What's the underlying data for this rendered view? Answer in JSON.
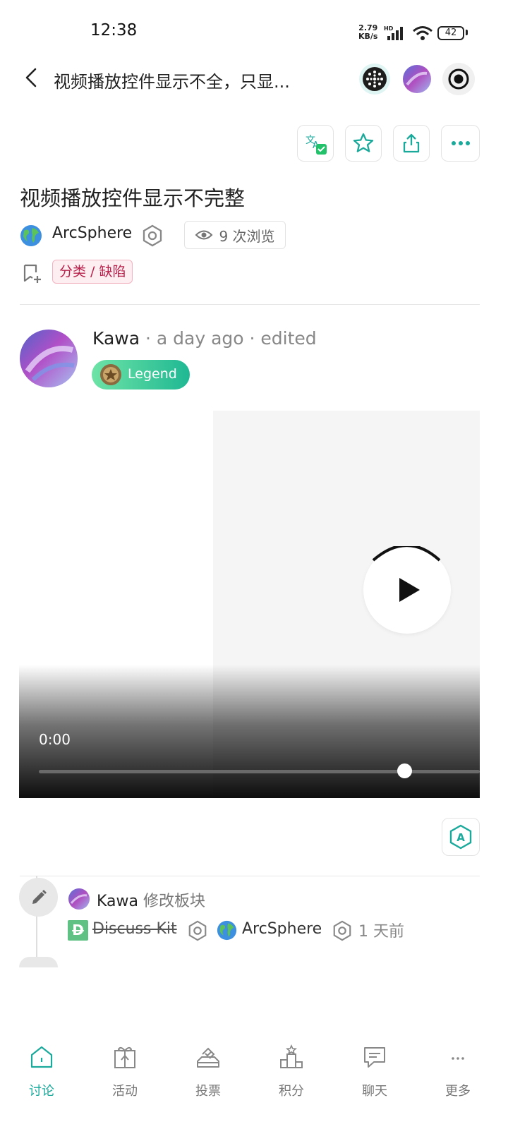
{
  "status_bar": {
    "time": "12:38",
    "net_speed": "2.79",
    "net_unit": "KB/s",
    "hd": "HD",
    "battery": "42"
  },
  "header": {
    "title": "视频播放控件显示不全，只显..."
  },
  "topic": {
    "title": "视频播放控件显示不完整",
    "category": "ArcSphere",
    "views": "9 次浏览",
    "tag": "分类 / 缺陷"
  },
  "post": {
    "author": "Kawa",
    "time_ago": "a day ago",
    "edited": "edited",
    "badge": "Legend",
    "video": {
      "current_time": "0:00",
      "progress": 0.83
    }
  },
  "small_action": {
    "user": "Kawa",
    "verb": "修改板块",
    "old_category": "Discuss Kit",
    "new_category": "ArcSphere",
    "time_ago": "1 天前",
    "old_logo_letter": "D"
  },
  "bottom_nav": {
    "items": [
      {
        "label": "讨论",
        "active": true
      },
      {
        "label": "活动",
        "active": false
      },
      {
        "label": "投票",
        "active": false
      },
      {
        "label": "积分",
        "active": false
      },
      {
        "label": "聊天",
        "active": false
      },
      {
        "label": "更多",
        "active": false
      }
    ]
  },
  "colors": {
    "accent": "#1aa99b",
    "tag_text": "#b8214b",
    "tag_bg": "#fdeef1",
    "badge_start": "#6ee3a6",
    "badge_end": "#1fb893"
  }
}
